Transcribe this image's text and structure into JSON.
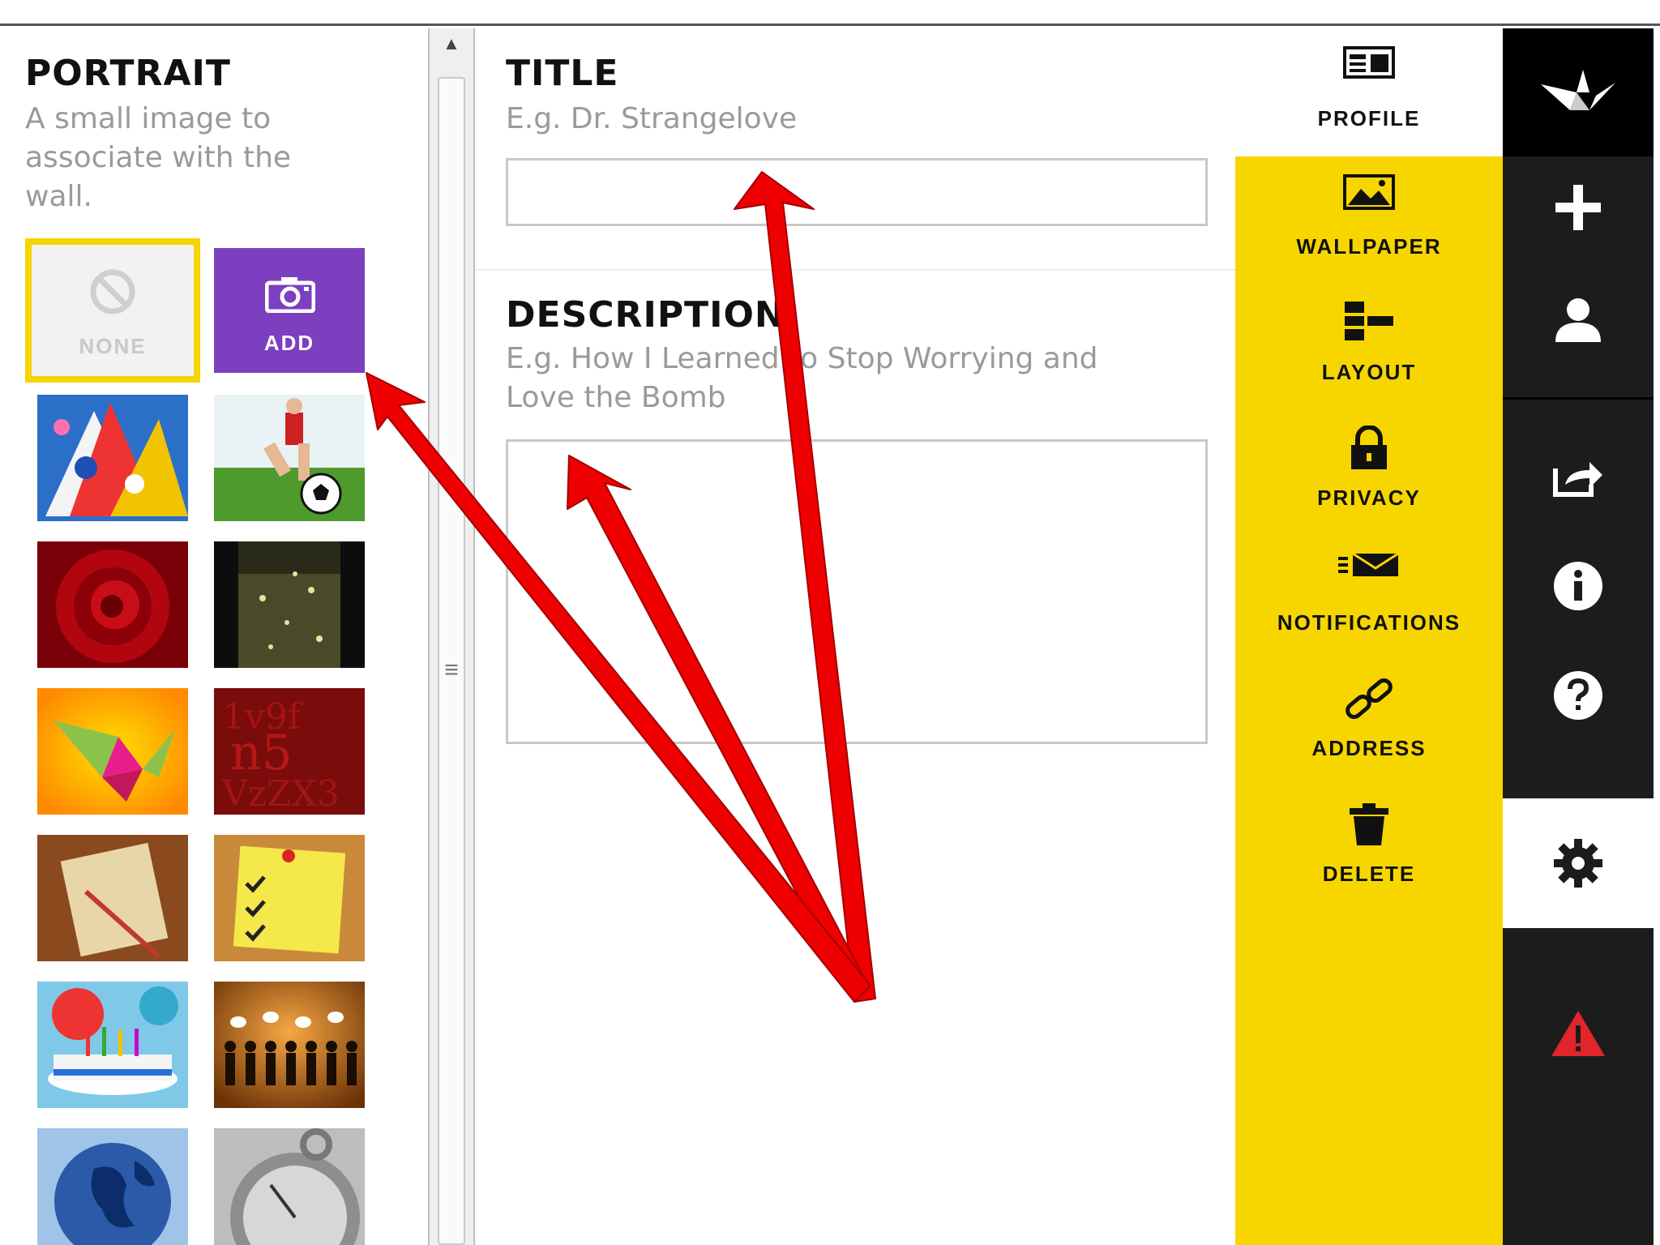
{
  "portrait": {
    "title": "PORTRAIT",
    "subtitle_lines": [
      "A small image to",
      "associate with the",
      "wall."
    ],
    "none_label": "NONE",
    "add_label": "ADD",
    "thumbnails": [
      "party-hats",
      "soccer-kick",
      "red-rose",
      "champagne",
      "paper-crane",
      "red-numbers",
      "notebook-pencil",
      "sticky-note-checklist",
      "birthday-cake",
      "people-crowd",
      "globe",
      "stopwatch"
    ]
  },
  "title_field": {
    "label": "TITLE",
    "placeholder": "E.g. Dr. Strangelove",
    "value": ""
  },
  "description_field": {
    "label": "DESCRIPTION",
    "placeholder_lines": [
      "E.g. How I Learned to Stop Worrying and",
      "Love the Bomb"
    ],
    "value": ""
  },
  "nav": {
    "items": [
      {
        "label": "PROFILE",
        "icon": "profile-card-icon"
      },
      {
        "label": "WALLPAPER",
        "icon": "image-icon"
      },
      {
        "label": "LAYOUT",
        "icon": "layout-icon"
      },
      {
        "label": "PRIVACY",
        "icon": "lock-icon"
      },
      {
        "label": "NOTIFICATIONS",
        "icon": "envelope-icon"
      },
      {
        "label": "ADDRESS",
        "icon": "link-icon"
      },
      {
        "label": "DELETE",
        "icon": "trash-icon"
      }
    ]
  },
  "sidebar": {
    "icons": [
      "crane-logo-icon",
      "plus-icon",
      "user-icon",
      "share-icon",
      "info-icon",
      "help-icon",
      "gear-icon",
      "warning-icon"
    ]
  },
  "colors": {
    "accent_yellow": "#f7d600",
    "add_purple": "#7b3fbf",
    "annotation_red": "#ee0000",
    "sidebar_black": "#1c1c1c",
    "warning_red": "#e0252b"
  }
}
